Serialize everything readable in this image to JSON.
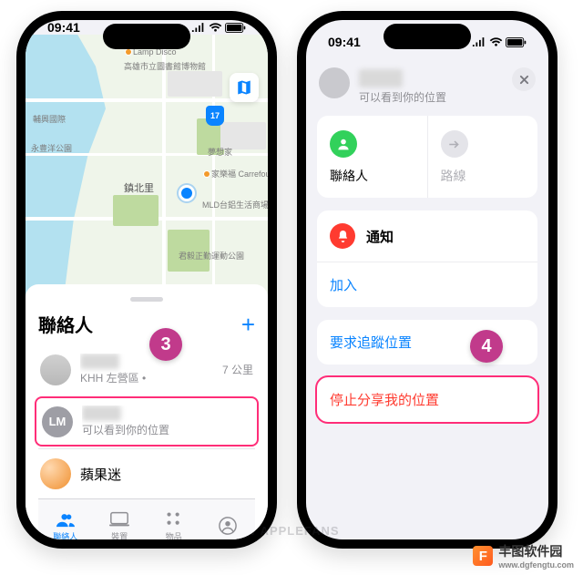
{
  "status": {
    "time": "09:41"
  },
  "map": {
    "place_label": "鎮北里",
    "shield": "17",
    "poi": {
      "park1": "永豊洋公園",
      "inter": "輔興國際",
      "muse": "高雄市立圖書館博物館",
      "lamp": "Lamp Disco",
      "carrefour": "家樂福 Carrefour",
      "mld": "MLD台鋁生活商場",
      "dream": "夢想家",
      "sport": "君毅正勤運動公園"
    }
  },
  "left": {
    "sheet_title": "聯絡人",
    "plus": "+",
    "rows": [
      {
        "name": "████",
        "sub": "KHH 左營區 •",
        "meta": "7 公里"
      },
      {
        "avatar": "LM",
        "name": "████",
        "sub": "可以看到你的位置"
      },
      {
        "name": "蘋果迷"
      }
    ],
    "tabs": [
      {
        "id": "people",
        "label": "聯絡人"
      },
      {
        "id": "devices",
        "label": "裝置"
      },
      {
        "id": "items",
        "label": "物品"
      },
      {
        "id": "me",
        "label": ""
      }
    ]
  },
  "right": {
    "name": "████",
    "sub": "可以看到你的位置",
    "tiles": {
      "contact": "聯絡人",
      "route": "路線"
    },
    "notify_label": "通知",
    "add_label": "加入",
    "request_label": "要求追蹤位置",
    "stop_label": "停止分享我的位置"
  },
  "steps": {
    "three": "3",
    "four": "4"
  },
  "watermark_af": "⌘ APPLEFANS",
  "footermark": {
    "logo": "F",
    "name": "丰图软件园",
    "url": "www.dgfengtu.com"
  }
}
